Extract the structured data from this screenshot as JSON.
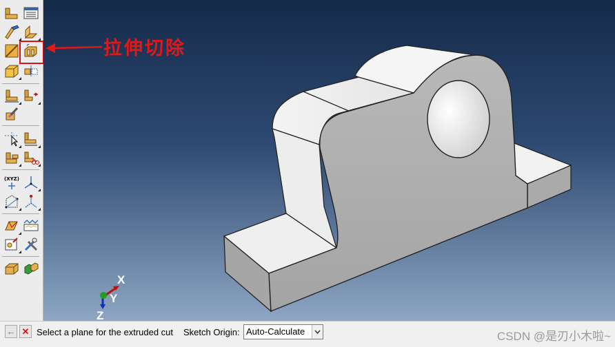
{
  "toolbox": {
    "tools": [
      {
        "name": "create-part-icon"
      },
      {
        "name": "part-manager-icon"
      },
      {
        "name": "create-solid-extrude-icon"
      },
      {
        "name": "create-shell-extrude-icon"
      },
      {
        "name": "create-wire-icon"
      },
      {
        "name": "create-cut-extrude-icon",
        "selected": true
      },
      {
        "name": "create-round-fillet-icon"
      },
      {
        "name": "create-datum-icon"
      },
      {
        "name": "partition-cell-icon"
      },
      {
        "name": "partition-face-icon"
      },
      {
        "name": "repair-edge-icon"
      },
      {
        "name": "query-icon"
      },
      {
        "name": "create-set-icon"
      },
      {
        "name": "create-surface-icon"
      },
      {
        "name": "create-reference-point-icon"
      },
      {
        "name": "datum-coordinate-system-icon"
      },
      {
        "name": "datum-point-icon"
      },
      {
        "name": "datum-axis-icon"
      },
      {
        "name": "mesh-seed-icon"
      },
      {
        "name": "mesh-controls-icon"
      },
      {
        "name": "verify-mesh-icon"
      },
      {
        "name": "tools-settings-icon"
      },
      {
        "name": "assign-section-icon"
      },
      {
        "name": "material-manager-icon"
      }
    ],
    "xyz_label": "(XYZ)"
  },
  "annotation": {
    "label": "拉伸切除",
    "color": "#e01818"
  },
  "viewport": {
    "triad": {
      "x_label": "X",
      "y_label": "Y",
      "z_label": "Z"
    }
  },
  "prompt": {
    "message": "Select a plane for the extruded cut",
    "sketch_origin_label": "Sketch Origin:",
    "sketch_origin_value": "Auto-Calculate"
  },
  "watermark": "CSDN @是刃小木啦~",
  "colors": {
    "accent": "#e01818",
    "viewport_top": "#152a4a",
    "viewport_bottom": "#8ea6c4"
  }
}
